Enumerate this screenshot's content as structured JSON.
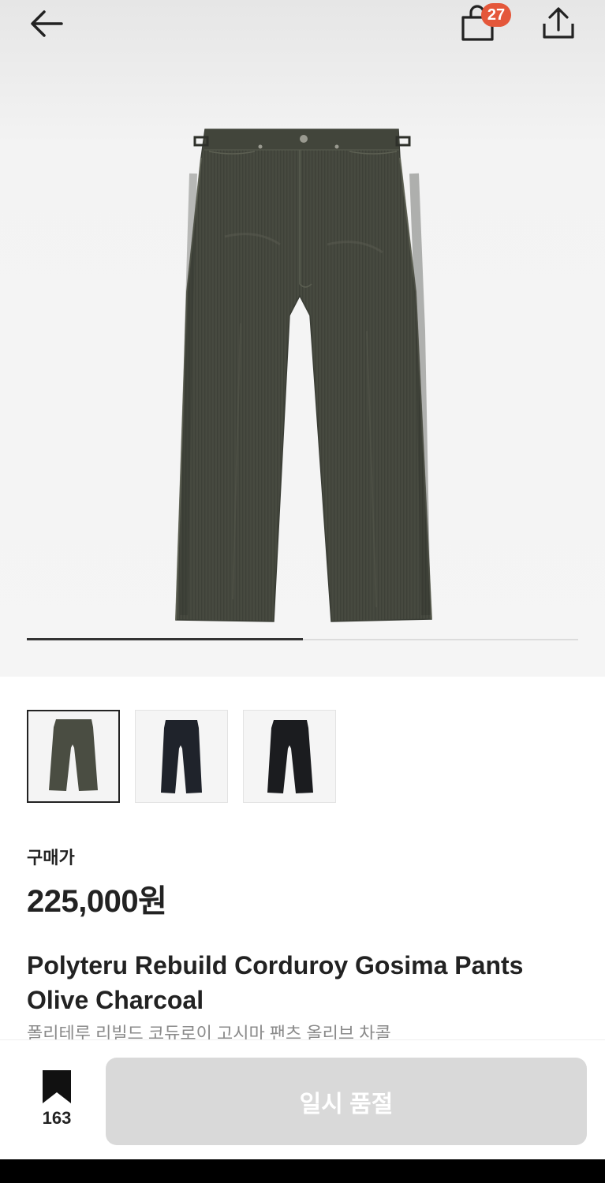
{
  "header": {
    "back_icon": "arrow-left-icon",
    "bag_icon": "shopping-bag-icon",
    "bag_count": "27",
    "share_icon": "share-upload-icon",
    "badge_color": "#e4573a"
  },
  "gallery": {
    "progress": 0.5,
    "thumbnails": [
      {
        "label": "olive-charcoal",
        "color": "#4a4d42",
        "selected": true
      },
      {
        "label": "black-navy",
        "color": "#1f232b",
        "selected": false
      },
      {
        "label": "black",
        "color": "#1b1c1f",
        "selected": false
      }
    ]
  },
  "product": {
    "price_label": "구매가",
    "price": "225,000원",
    "title_line1": "Polyteru Rebuild Corduroy Gosima Pants",
    "title_line2": "Olive Charcoal",
    "subtitle": "폴리테루 리빌드 코듀로이 고시마 팬츠 올리브 차콜"
  },
  "bottom": {
    "wishlist_icon": "bookmark-icon",
    "wishlist_count": "163",
    "buy_button_label": "일시 품절",
    "buy_button_color": "#d9d9d9"
  }
}
